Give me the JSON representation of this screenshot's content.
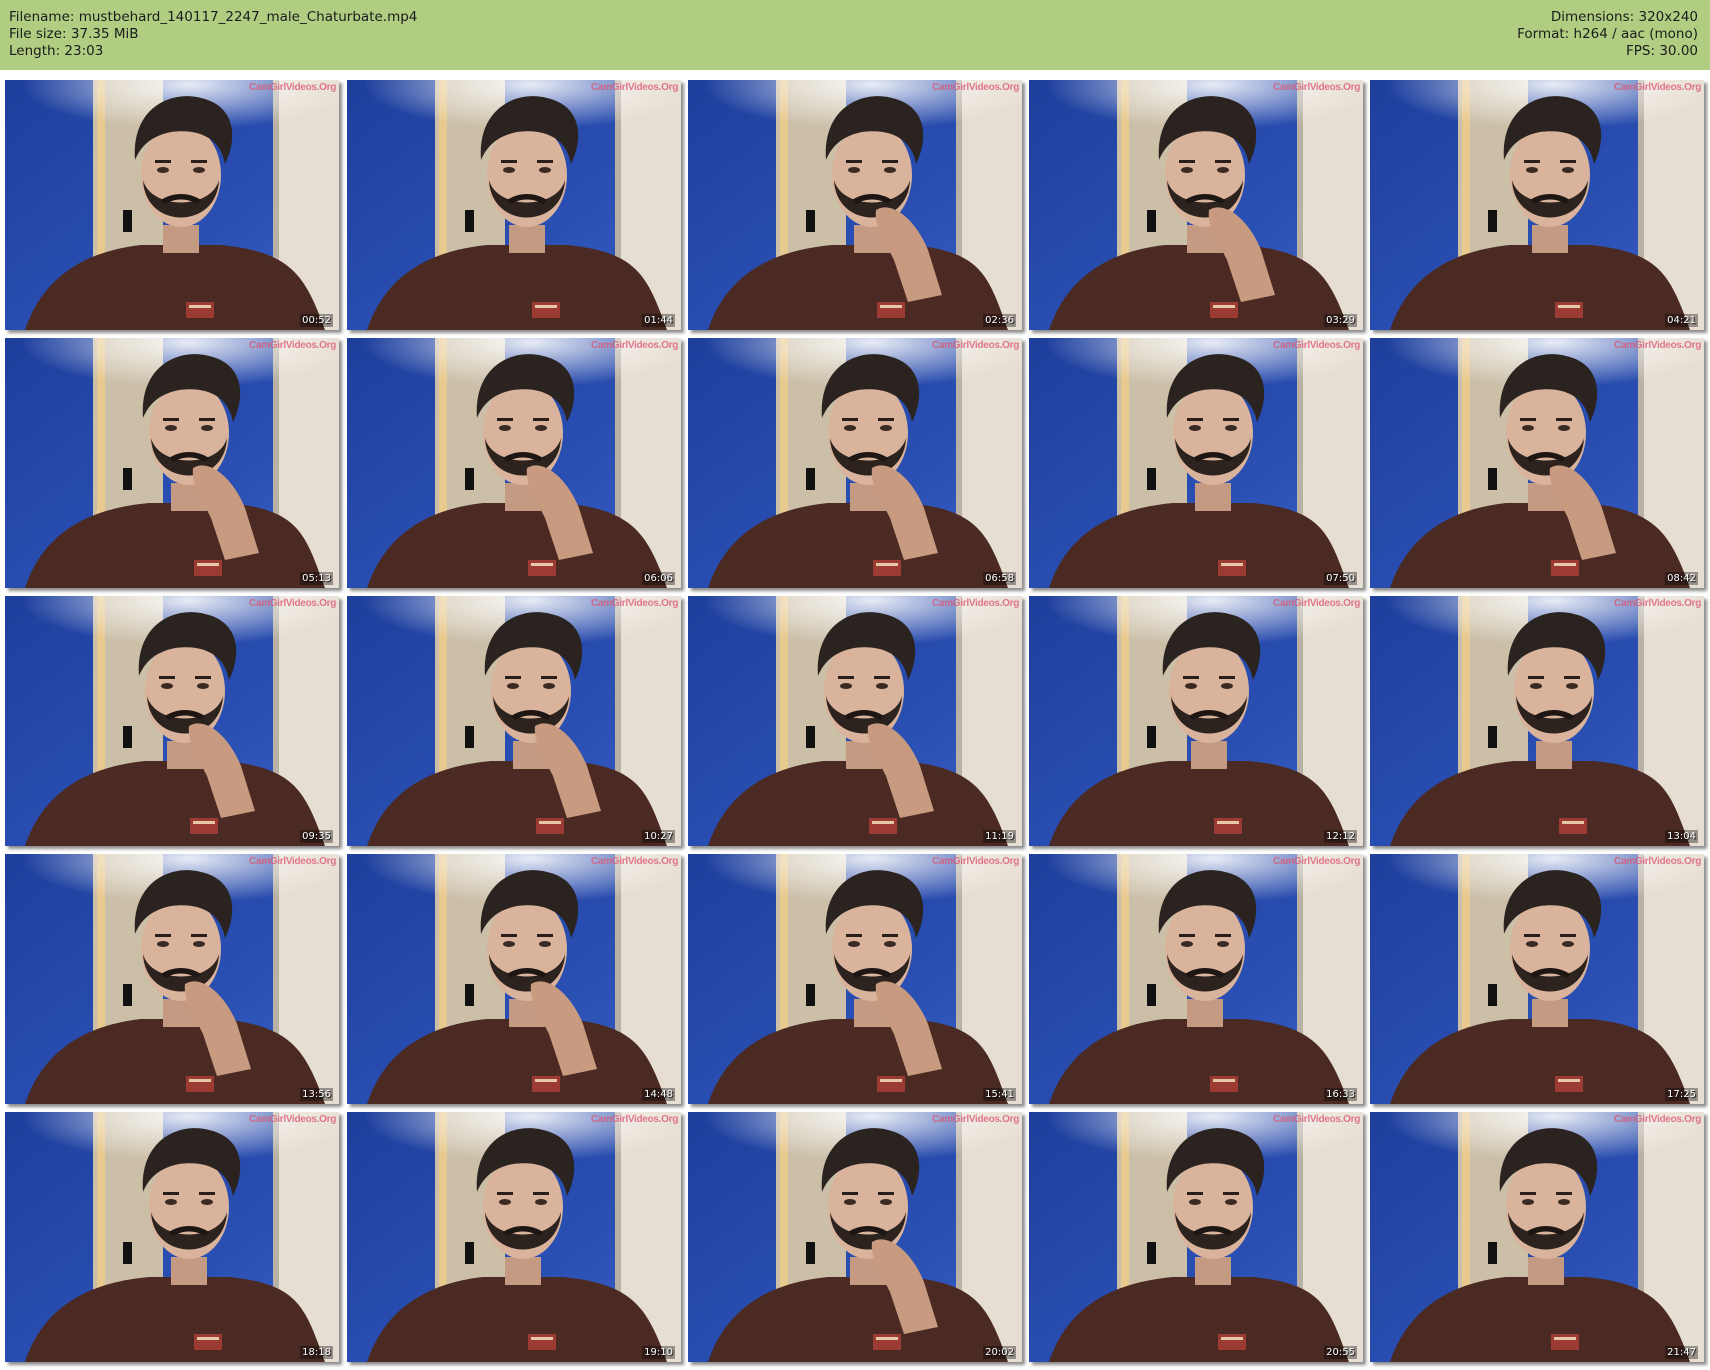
{
  "header": {
    "filename": "Filename: mustbehard_140117_2247_male_Chaturbate.mp4",
    "file_size": "File size: 37.35 MiB",
    "length": "Length: 23:03",
    "dimensions": "Dimensions: 320x240",
    "format": "Format: h264 / aac (mono)",
    "fps": "FPS: 30.00"
  },
  "watermark": "CamGirlVideos.Org",
  "colors": {
    "header_bg": "#b1cd82",
    "wall_blue": "#2a4fb3",
    "door_beige": "#e6ded2",
    "shirt_brown": "#4a2a22",
    "hair": "#2a2320"
  },
  "thumbnails": [
    {
      "time": "00:52",
      "hand": false
    },
    {
      "time": "01:44",
      "hand": false
    },
    {
      "time": "02:36",
      "hand": true
    },
    {
      "time": "03:29",
      "hand": true
    },
    {
      "time": "04:21",
      "hand": false
    },
    {
      "time": "05:13",
      "hand": true
    },
    {
      "time": "06:06",
      "hand": true
    },
    {
      "time": "06:58",
      "hand": true
    },
    {
      "time": "07:50",
      "hand": false
    },
    {
      "time": "08:42",
      "hand": true
    },
    {
      "time": "09:35",
      "hand": true
    },
    {
      "time": "10:27",
      "hand": true
    },
    {
      "time": "11:19",
      "hand": true
    },
    {
      "time": "12:12",
      "hand": false
    },
    {
      "time": "13:04",
      "hand": false
    },
    {
      "time": "13:56",
      "hand": true
    },
    {
      "time": "14:48",
      "hand": true
    },
    {
      "time": "15:41",
      "hand": true
    },
    {
      "time": "16:33",
      "hand": false
    },
    {
      "time": "17:25",
      "hand": false
    },
    {
      "time": "18:18",
      "hand": false
    },
    {
      "time": "19:10",
      "hand": false
    },
    {
      "time": "20:02",
      "hand": true
    },
    {
      "time": "20:55",
      "hand": false
    },
    {
      "time": "21:47",
      "hand": false
    }
  ]
}
